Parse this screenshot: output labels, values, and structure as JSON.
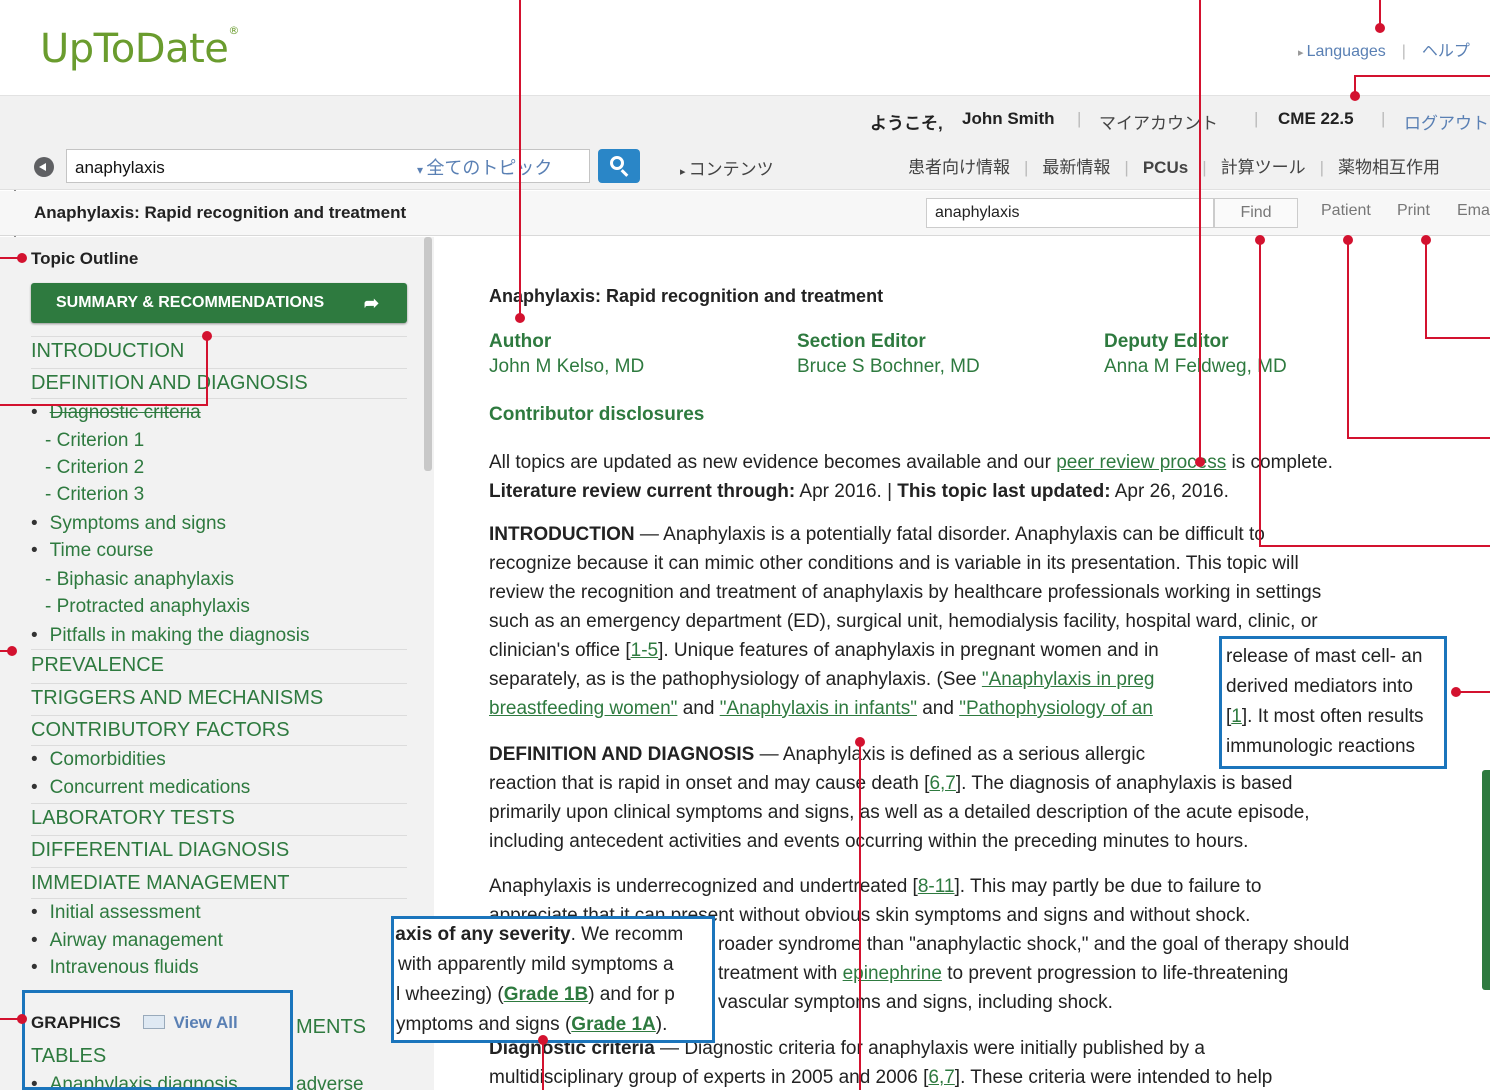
{
  "header": {
    "logo": "UpToDate",
    "logo_mark": "®",
    "languages": "Languages",
    "help": "ヘルプ"
  },
  "userbar": {
    "welcome": "ようこそ,",
    "user": "John Smith",
    "my_account": "マイアカウント",
    "cme": "CME 22.5",
    "logout": "ログアウト"
  },
  "search": {
    "query": "anaphylaxis",
    "scope": "全てのトピック",
    "contents": "コンテンツ",
    "nav": [
      "患者向け情報",
      "最新情報",
      "PCUs",
      "計算ツール",
      "薬物相互作用"
    ]
  },
  "topic_bar": {
    "title": "Anaphylaxis: Rapid recognition and treatment",
    "find_value": "anaphylaxis",
    "find_button": "Find",
    "patient": "Patient",
    "print": "Print",
    "email": "Email"
  },
  "sidebar": {
    "outline_title": "Topic Outline",
    "summary_button": "SUMMARY & RECOMMENDATIONS",
    "items": [
      {
        "kind": "sec",
        "label": "INTRODUCTION"
      },
      {
        "kind": "sec",
        "label": "DEFINITION AND DIAGNOSIS"
      },
      {
        "kind": "sub",
        "label": "Diagnostic criteria"
      },
      {
        "kind": "crit",
        "label": "- Criterion 1"
      },
      {
        "kind": "crit",
        "label": "- Criterion 2"
      },
      {
        "kind": "crit",
        "label": "- Criterion 3"
      },
      {
        "kind": "sub",
        "label": "Symptoms and signs"
      },
      {
        "kind": "sub",
        "label": "Time course"
      },
      {
        "kind": "crit",
        "label": "- Biphasic anaphylaxis"
      },
      {
        "kind": "crit",
        "label": "- Protracted anaphylaxis"
      },
      {
        "kind": "sub",
        "label": "Pitfalls in making the diagnosis"
      },
      {
        "kind": "sec",
        "label": "PREVALENCE"
      },
      {
        "kind": "sec",
        "label": "TRIGGERS AND MECHANISMS"
      },
      {
        "kind": "sec",
        "label": "CONTRIBUTORY FACTORS"
      },
      {
        "kind": "sub",
        "label": "Comorbidities"
      },
      {
        "kind": "sub",
        "label": "Concurrent medications"
      },
      {
        "kind": "sec",
        "label": "LABORATORY TESTS"
      },
      {
        "kind": "sec",
        "label": "DIFFERENTIAL DIAGNOSIS"
      },
      {
        "kind": "sec",
        "label": "IMMEDIATE MANAGEMENT"
      },
      {
        "kind": "sub",
        "label": "Initial assessment"
      },
      {
        "kind": "sub",
        "label": "Airway management"
      },
      {
        "kind": "sub",
        "label": "Intravenous fluids"
      }
    ],
    "graphics_label": "GRAPHICS",
    "view_all": "View All",
    "ments_partial": "MENTS",
    "tables_label": "TABLES",
    "table_item": "Anaphylaxis diagnosis",
    "adverse_partial": "adverse"
  },
  "article": {
    "heading": "Anaphylaxis: Rapid recognition and treatment",
    "author_label": "Author",
    "author": "John M Kelso, MD",
    "section_editor_label": "Section Editor",
    "section_editor": "Bruce S Bochner, MD",
    "deputy_editor_label": "Deputy Editor",
    "deputy_editor": "Anna M Feldweg, MD",
    "disclosures": "Contributor disclosures",
    "updated_pre": "All topics are updated as new evidence becomes available and our ",
    "peer_review": "peer review process",
    "updated_post": " is complete.",
    "lit_label": "Literature review current through:",
    "lit_value": " Apr 2016. | ",
    "last_updated_label": "This topic last updated:",
    "last_updated_value": " Apr 26, 2016.",
    "intro_heading": "INTRODUCTION",
    "intro_lines": [
      " — Anaphylaxis is a potentially fatal disorder. Anaphylaxis can be difficult to",
      "recognize because it can mimic other conditions and is variable in its presentation. This topic will",
      "review the recognition and treatment of anaphylaxis by healthcare professionals working in settings",
      "such as an emergency department (ED), surgical unit, hemodialysis facility, hospital ward, clinic, or"
    ],
    "intro_l5_pre": "clinician's office [",
    "intro_l5_ref": "1-5",
    "intro_l5_post": "]. Unique features of anaphylaxis in pregnant women and in",
    "intro_l6_pre": "separately, as is the pathophysiology of anaphylaxis. (See ",
    "intro_l6_link": "\"Anaphylaxis in preg",
    "intro_l7_link1": "breastfeeding women\"",
    "intro_l7_and1": " and ",
    "intro_l7_link2": "\"Anaphylaxis in infants\"",
    "intro_l7_and2": " and ",
    "intro_l7_link3": "\"Pathophysiology of an",
    "def_heading": "DEFINITION AND DIAGNOSIS",
    "def_l1": " — Anaphylaxis is defined as a serious allergic",
    "def_l2_pre": "reaction that is rapid in onset and may cause death [",
    "def_l2_ref": "6,7",
    "def_l2_post": "]. The diagnosis of anaphylaxis is based",
    "def_l3": "primarily upon clinical symptoms and signs, as well as a detailed description of the acute episode,",
    "def_l4": "including antecedent activities and events occurring within the preceding minutes to hours.",
    "under_l1_pre": "Anaphylaxis is underrecognized and undertreated [",
    "under_l1_ref": "8-11",
    "under_l1_post": "]. This may partly be due to failure to",
    "under_l2": "appreciate that it can present without obvious skin symptoms and signs and without shock.",
    "under_l3": "roader syndrome than \"anaphylactic shock,\" and the goal of therapy should",
    "under_l4_pre": "treatment with ",
    "under_l4_link": "epinephrine",
    "under_l4_post": " to prevent progression to life-threatening",
    "under_l5": "vascular symptoms and signs, including shock.",
    "crit_heading": "Diagnostic criteria",
    "crit_l1": " — Diagnostic criteria for anaphylaxis were initially published by a",
    "crit_l2_pre": "multidisciplinary group of experts in 2005 and 2006 [",
    "crit_l2_ref": "6,7",
    "crit_l2_post": "]. These criteria were intended to help"
  },
  "callout_right": {
    "lines": [
      "release of mast cell- an",
      "derived mediators into",
      "[1]. It most often results",
      "immunologic reactions"
    ]
  },
  "callout_left": {
    "l1_bold": "laxis of any severity",
    "l1_rest": ". We recomm",
    "l2": "with apparently mild symptoms a",
    "l3_pre": "l wheezing) (",
    "l3_link": "Grade 1B",
    "l3_post": ") and for p",
    "l4_pre": "ymptoms and signs (",
    "l4_link": "Grade 1A",
    "l4_post": ")."
  },
  "colors": {
    "brand_green": "#6a9c2e",
    "section_green": "#2e7a3f",
    "link_blue": "#5a80b4",
    "search_button": "#2a86c7",
    "callout_border": "#1b75bc",
    "annotation_red": "#d3122f"
  }
}
